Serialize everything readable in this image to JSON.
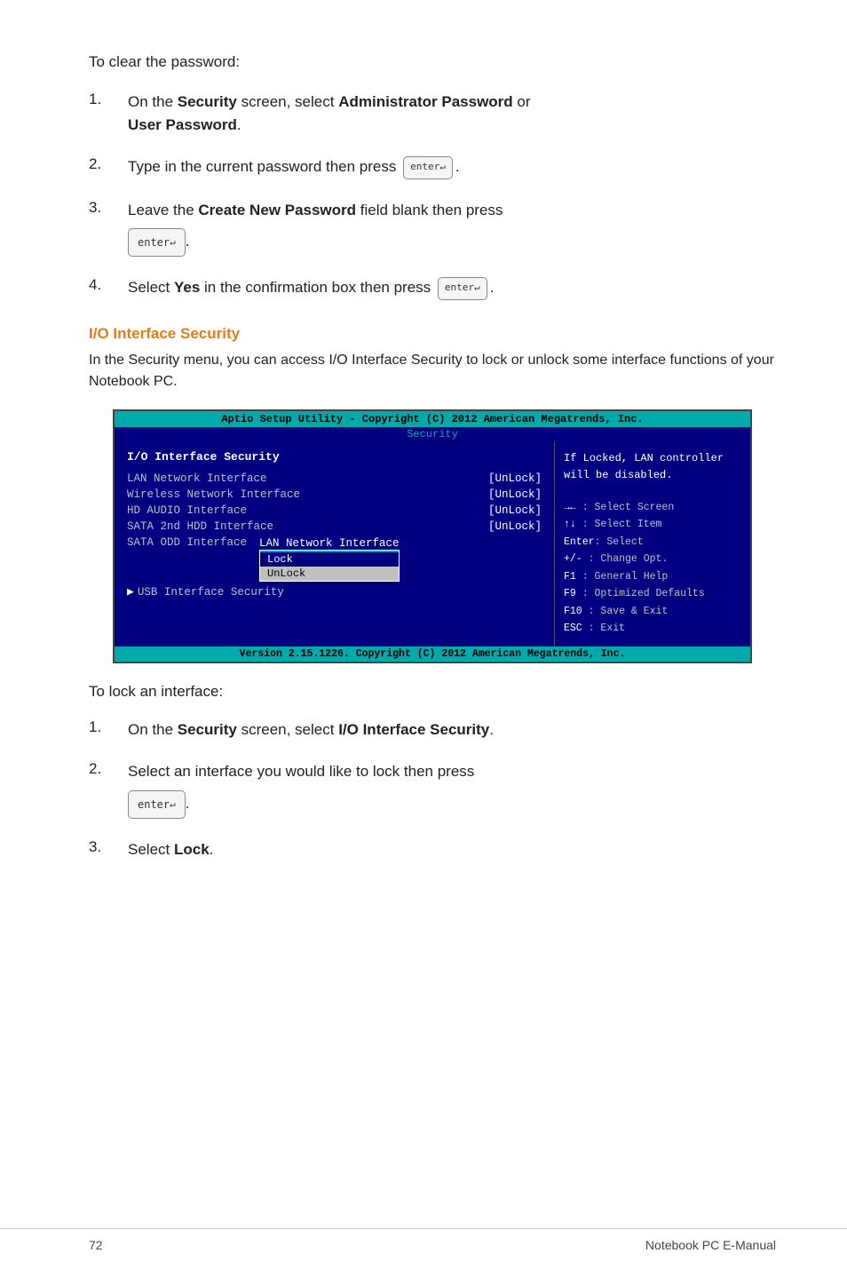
{
  "intro": "To clear the password:",
  "clear_steps": [
    {
      "num": "1.",
      "text_before": "On the ",
      "bold1": "Security",
      "text_mid1": " screen, select ",
      "bold2": "Administrator Password",
      "text_mid2": " or",
      "newline": "User Password",
      "bold_newline": true,
      "period": "."
    },
    {
      "num": "2.",
      "text": "Type in the current password then press",
      "enter": true
    },
    {
      "num": "3.",
      "text_before": "Leave the ",
      "bold1": "Create New Password",
      "text_after": " field blank then press",
      "enter_block": true
    },
    {
      "num": "4.",
      "text_before": "Select ",
      "bold1": "Yes",
      "text_after": " in the confirmation box then press",
      "enter": true
    }
  ],
  "section_heading": "I/O Interface Security",
  "section_text": "In the Security menu, you can access I/O Interface Security to lock or unlock some interface functions of your Notebook PC.",
  "bios": {
    "topbar": "Aptio Setup Utility - Copyright (C) 2012 American Megatrends, Inc.",
    "tab": "Security",
    "title": "I/O Interface Security",
    "help_text": "If Locked, LAN controller will be disabled.",
    "rows": [
      {
        "label": "LAN Network Interface",
        "value": "[UnLock]"
      },
      {
        "label": "Wireless Network Interface",
        "value": "[UnLock]"
      },
      {
        "label": "HD AUDIO Interface",
        "value": "[UnLock]"
      },
      {
        "label": "SATA 2nd HDD Interface",
        "value": "[UnLock]"
      }
    ],
    "odd_label": "SATA ODD Interface",
    "popup_header": "LAN Network Interface",
    "popup_items": [
      "Lock",
      "UnLock"
    ],
    "selected_popup": 0,
    "usb_label": "USB Interface Security",
    "keys": [
      {
        "key": "→←",
        "desc": ": Select Screen"
      },
      {
        "key": "↑↓",
        "desc": ": Select Item"
      },
      {
        "key": "Enter",
        "desc": ": Select"
      },
      {
        "key": "+/-",
        "desc": ": Change Opt."
      },
      {
        "key": "F1",
        "desc": ": General Help"
      },
      {
        "key": "F9",
        "desc": ": Optimized Defaults"
      },
      {
        "key": "F10",
        "desc": ": Save & Exit"
      },
      {
        "key": "ESC",
        "desc": ": Exit"
      }
    ],
    "bottombar": "Version 2.15.1226. Copyright (C) 2012 American Megatrends, Inc."
  },
  "to_lock_intro": "To lock an interface:",
  "lock_steps": [
    {
      "num": "1.",
      "text_before": "On the ",
      "bold1": "Security",
      "text_after": " screen, select ",
      "bold2": "I/O Interface Security",
      "period": "."
    },
    {
      "num": "2.",
      "text": "Select an interface you would like to lock then press",
      "enter_block": true
    },
    {
      "num": "3.",
      "text_before": "Select ",
      "bold1": "Lock",
      "period": "."
    }
  ],
  "footer": {
    "page_num": "72",
    "title": "Notebook PC E-Manual"
  },
  "enter_label": "enter",
  "enter_arrow": "↵"
}
